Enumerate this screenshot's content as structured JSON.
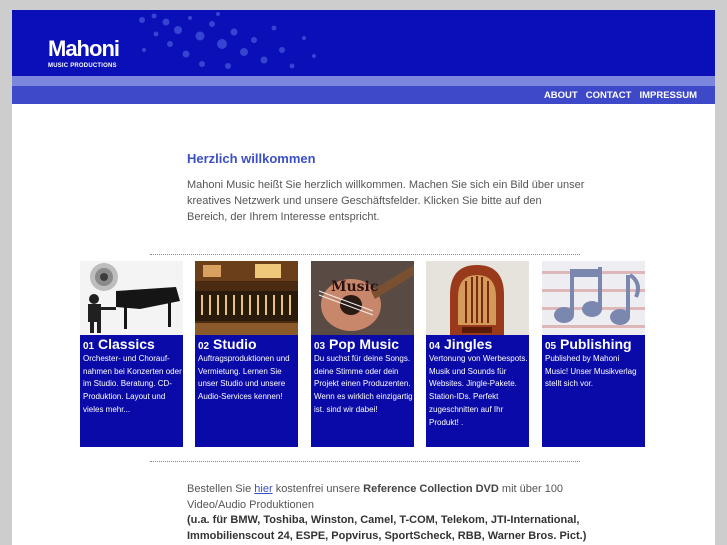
{
  "brand": {
    "logo_text": "Mahoni",
    "logo_subtitle": "MUSIC PRODUCTIONS"
  },
  "colors": {
    "header_blue": "#0b0fb8",
    "navbar_blue": "#3e49c9",
    "card_blue": "#0a0aa8",
    "title_blue": "#3b50c8"
  },
  "nav": {
    "items": [
      "ABOUT",
      "CONTACT",
      "IMPRESSUM"
    ]
  },
  "welcome": {
    "title": "Herzlich willkommen",
    "text": "Mahoni Music heißt Sie herzlich willkommen. Machen Sie sich ein Bild über unser kreatives Netzwerk und unsere Geschäftsfelder. Klicken Sie bitte auf den Bereich, der Ihrem Interesse entspricht."
  },
  "cards": [
    {
      "num": "01",
      "title": "Classics",
      "image": "piano-player-icon",
      "desc": "Orchester- und Chorauf­nahmen bei Konzerten oder im Studio. Beratung. CD-Produktion. Layout und vieles mehr..."
    },
    {
      "num": "02",
      "title": "Studio",
      "image": "recording-studio-icon",
      "desc": "Auftragsproduktionen und Vermietung. Lernen Sie unser Studio und unsere Audio-Services kennen!"
    },
    {
      "num": "03",
      "title": "Pop Music",
      "image": "guitar-icon",
      "desc": "Du suchst für deine Songs. deine Stimme oder dein Projekt einen Produzenten. Wenn es wirklich einzigartig ist. sind wir dabei!"
    },
    {
      "num": "04",
      "title": "Jingles",
      "image": "vintage-radio-icon",
      "desc": "Vertonung von Werbespots. Musik und Sounds für Websites. Jingle-Pakete. Station-IDs. Perfekt zugeschnitten auf Ihr Produkt! ."
    },
    {
      "num": "05",
      "title": "Publishing",
      "image": "music-notes-icon",
      "desc": "Published by Mahoni Music! Unser Musikverlag stellt sich vor."
    }
  ],
  "order": {
    "prefix": "Bestellen Sie",
    "link": "hier",
    "middle": "kostenfrei unsere",
    "product": "Reference Collection DVD",
    "suffix": "mit über 100 Video/Audio Produktionen",
    "clients": "(u.a. für BMW, Toshiba, Winston, Camel, T-COM, Telekom, JTI-International, Immobilienscout 24, ESPE, Popvirus, SportScheck, RBB, Warner Bros. Pict.)"
  }
}
